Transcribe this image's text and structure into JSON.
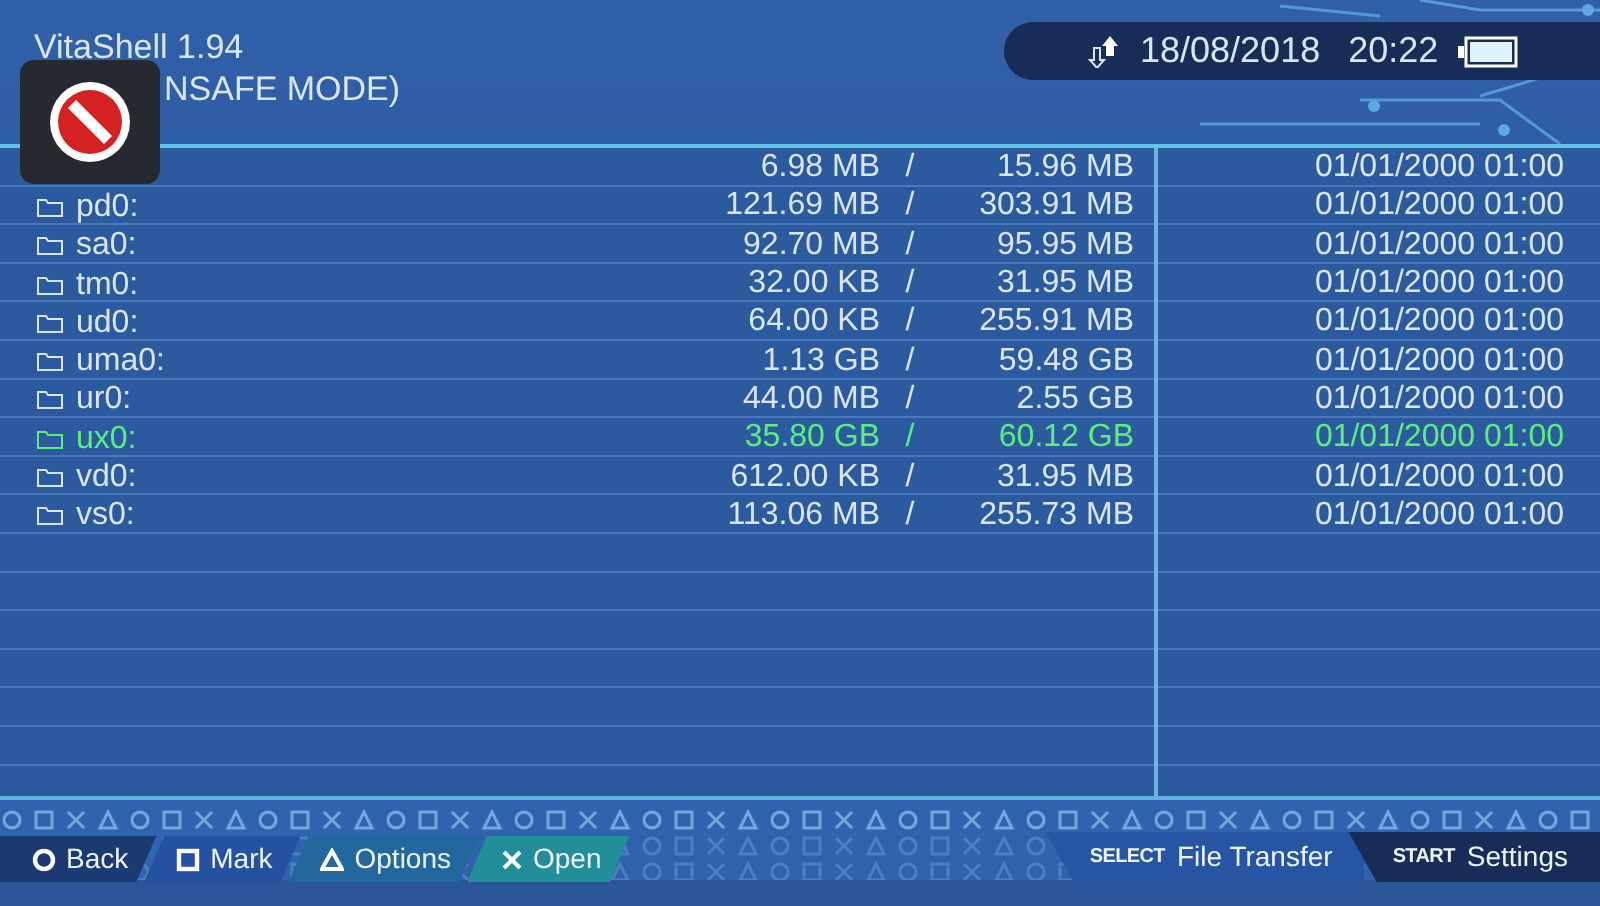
{
  "header": {
    "title": "VitaShell 1.94",
    "subtitle": "NSAFE MODE)",
    "date": "18/08/2018",
    "time": "20:22"
  },
  "rows": [
    {
      "name": "",
      "used": "6.98 MB",
      "separator": "/",
      "total": "15.96 MB",
      "date": "01/01/2000 01:00",
      "selected": false
    },
    {
      "name": "pd0:",
      "used": "121.69 MB",
      "separator": "/",
      "total": "303.91 MB",
      "date": "01/01/2000 01:00",
      "selected": false
    },
    {
      "name": "sa0:",
      "used": "92.70 MB",
      "separator": "/",
      "total": "95.95 MB",
      "date": "01/01/2000 01:00",
      "selected": false
    },
    {
      "name": "tm0:",
      "used": "32.00 KB",
      "separator": "/",
      "total": "31.95 MB",
      "date": "01/01/2000 01:00",
      "selected": false
    },
    {
      "name": "ud0:",
      "used": "64.00 KB",
      "separator": "/",
      "total": "255.91 MB",
      "date": "01/01/2000 01:00",
      "selected": false
    },
    {
      "name": "uma0:",
      "used": "1.13 GB",
      "separator": "/",
      "total": "59.48 GB",
      "date": "01/01/2000 01:00",
      "selected": false
    },
    {
      "name": "ur0:",
      "used": "44.00 MB",
      "separator": "/",
      "total": "2.55 GB",
      "date": "01/01/2000 01:00",
      "selected": false
    },
    {
      "name": "ux0:",
      "used": "35.80 GB",
      "separator": "/",
      "total": "60.12 GB",
      "date": "01/01/2000 01:00",
      "selected": true
    },
    {
      "name": "vd0:",
      "used": "612.00 KB",
      "separator": "/",
      "total": "31.95 MB",
      "date": "01/01/2000 01:00",
      "selected": false
    },
    {
      "name": "vs0:",
      "used": "113.06 MB",
      "separator": "/",
      "total": "255.73 MB",
      "date": "01/01/2000 01:00",
      "selected": false
    }
  ],
  "footer_left": [
    {
      "kind": "circle",
      "label": "Back"
    },
    {
      "kind": "square",
      "label": "Mark"
    },
    {
      "kind": "triangle",
      "label": "Options"
    },
    {
      "kind": "cross",
      "label": "Open"
    }
  ],
  "footer_right": [
    {
      "key": "SELECT",
      "label": "File Transfer"
    },
    {
      "key": "START",
      "label": "Settings"
    }
  ]
}
